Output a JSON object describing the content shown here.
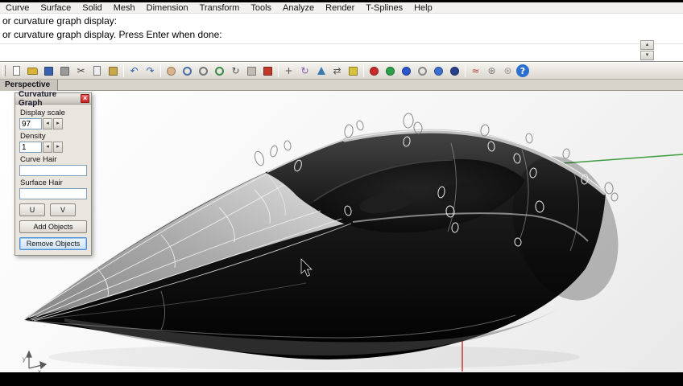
{
  "window": {
    "menu": [
      "Curve",
      "Surface",
      "Solid",
      "Mesh",
      "Dimension",
      "Transform",
      "Tools",
      "Analyze",
      "Render",
      "T-Splines",
      "Help"
    ]
  },
  "command": {
    "line1": "or curvature graph display:",
    "line2": "or curvature graph display. Press Enter when done:"
  },
  "toolbar": {
    "icons": [
      {
        "name": "new-file",
        "shape": "page",
        "color": "#ffffff"
      },
      {
        "name": "open-file",
        "shape": "folder",
        "color": "#d9b33c"
      },
      {
        "name": "save",
        "shape": "square",
        "color": "#3a62b0"
      },
      {
        "name": "print",
        "shape": "square",
        "color": "#9a9a9a"
      },
      {
        "name": "cut",
        "glyph": "✂",
        "color": "#444444"
      },
      {
        "name": "copy",
        "shape": "page",
        "color": "#eeeeee"
      },
      {
        "name": "paste",
        "shape": "square",
        "color": "#c8a84a"
      },
      {
        "sep": true
      },
      {
        "name": "undo",
        "glyph": "↶",
        "color": "#2d5fb0"
      },
      {
        "name": "redo",
        "glyph": "↷",
        "color": "#2d5fb0"
      },
      {
        "sep": true
      },
      {
        "name": "pan-view",
        "shape": "circle",
        "color": "#d9b38c"
      },
      {
        "name": "zoom-dynamic",
        "shape": "ring",
        "color": "#4a6fa5"
      },
      {
        "name": "zoom-window",
        "shape": "ring",
        "color": "#777777"
      },
      {
        "name": "zoom-extents",
        "shape": "ring",
        "color": "#3a8a4a"
      },
      {
        "name": "rotate-view",
        "glyph": "↻",
        "color": "#555555"
      },
      {
        "name": "named-views",
        "shape": "square",
        "color": "#c0bcb4"
      },
      {
        "name": "vehicle-display",
        "shape": "square",
        "color": "#c23a2a"
      },
      {
        "sep": true
      },
      {
        "name": "move",
        "glyph": "+",
        "color": "#555555"
      },
      {
        "name": "rotate",
        "glyph": "↻",
        "color": "#8a5ab0"
      },
      {
        "name": "scale",
        "shape": "tri",
        "color": "#3a7ab0"
      },
      {
        "name": "mirror",
        "glyph": "⇄",
        "color": "#555555"
      },
      {
        "name": "lock",
        "shape": "square",
        "color": "#d9c23c"
      },
      {
        "sep": true
      },
      {
        "name": "render-red-sphere",
        "shape": "circle",
        "color": "#cc2b2b"
      },
      {
        "name": "render-green-sphere",
        "shape": "circle",
        "color": "#2ba04a"
      },
      {
        "name": "render-blue-sphere",
        "shape": "circle",
        "color": "#2b57cc"
      },
      {
        "name": "torus",
        "shape": "ring",
        "color": "#888888"
      },
      {
        "name": "globe",
        "shape": "circle",
        "color": "#3a6fd0"
      },
      {
        "name": "shaded-sphere",
        "shape": "circle",
        "color": "#27408b"
      },
      {
        "sep": true
      },
      {
        "name": "curvature-graph",
        "glyph": "≈",
        "color": "#b0453a"
      },
      {
        "name": "options-gear",
        "glyph": "⊛",
        "color": "#777777"
      },
      {
        "name": "gears",
        "glyph": "⊛",
        "color": "#999999"
      },
      {
        "name": "help",
        "glyph": "?",
        "color": "#ffffff",
        "bg": "#2b6fd0"
      }
    ]
  },
  "viewport": {
    "label": "Perspective",
    "axis_x": "x",
    "axis_y": "y"
  },
  "dialog": {
    "title": "Curvature Graph",
    "display_scale_label": "Display scale",
    "display_scale_value": "97",
    "density_label": "Density",
    "density_value": "1",
    "curve_hair_label": "Curve Hair",
    "surface_hair_label": "Surface Hair",
    "u_label": "U",
    "v_label": "V",
    "add_objects_label": "Add Objects",
    "remove_objects_label": "Remove Objects"
  },
  "icons": {
    "close": "×",
    "spin_left": "◂",
    "spin_right": "▸",
    "scroll_up": "▴",
    "scroll_down": "▾"
  },
  "colors": {
    "axis_green": "#3f9b3f",
    "axis_red": "#cc3b3b",
    "focus_blue": "#4a90d9"
  }
}
